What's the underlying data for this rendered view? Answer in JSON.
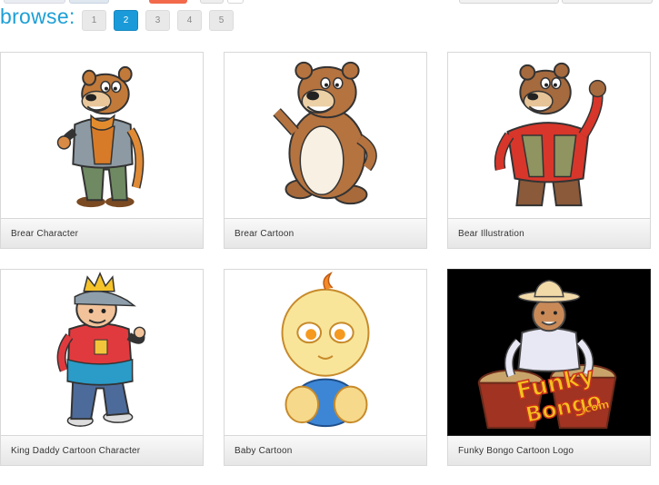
{
  "browse": {
    "label": "browse:"
  },
  "pager": {
    "pages": [
      "1",
      "2",
      "3",
      "4",
      "5"
    ],
    "current": "2"
  },
  "items": [
    {
      "title": "Brear Character"
    },
    {
      "title": "Brear Cartoon"
    },
    {
      "title": "Bear Illustration"
    },
    {
      "title": "King Daddy Cartoon Character"
    },
    {
      "title": "Baby Cartoon"
    },
    {
      "title": "Funky Bongo Cartoon Logo",
      "logo_text": [
        "Funky",
        "Bongo",
        ".com"
      ]
    }
  ],
  "colors": {
    "accent": "#1d9fd6",
    "active_page": "#1a9ad9"
  }
}
